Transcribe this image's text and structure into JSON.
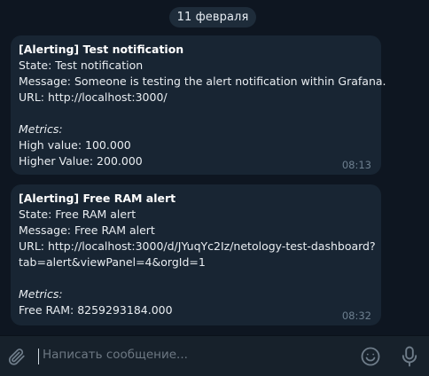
{
  "chat": {
    "date": "11 февраля",
    "messages": [
      {
        "title": "[Alerting] Test notification",
        "state": "State: Test notification",
        "message": "Message: Someone is testing the alert notification within Grafana.",
        "url_line1": "URL: http://localhost:3000/",
        "metrics_label": "Metrics:",
        "metric1": "High value: 100.000",
        "metric2": "Higher Value: 200.000",
        "time": "08:13"
      },
      {
        "title": "[Alerting] Free RAM alert",
        "state": "State: Free RAM alert",
        "message": "Message: Free RAM alert",
        "url_line1": "URL: http://localhost:3000/d/JYuqYc2Iz/netology-test-dashboard?",
        "url_line2": "tab=alert&viewPanel=4&orgId=1",
        "metrics_label": "Metrics:",
        "metric1": "Free RAM: 8259293184.000",
        "time": "08:32"
      }
    ]
  },
  "composer": {
    "placeholder": "Написать сообщение..."
  },
  "icons": {
    "attach": "paperclip-icon",
    "emoji": "smile-icon",
    "voice": "microphone-icon"
  },
  "colors": {
    "background": "#0e1621",
    "bubble": "#182533",
    "input_bar": "#17212b",
    "timestamp": "#6d7f8f"
  }
}
